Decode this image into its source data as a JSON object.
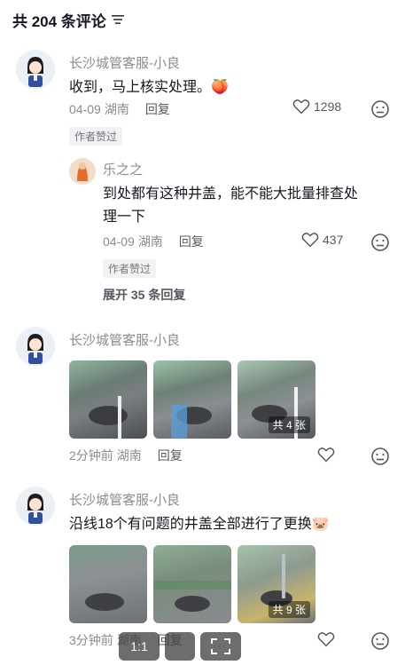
{
  "header": {
    "title": "共 204 条评论",
    "filter_icon": "filter-icon"
  },
  "comments": [
    {
      "author": "长沙城管客服-小良",
      "text": "收到，马上核实处理。",
      "emoji": "🍑",
      "time": "04-09",
      "location": "湖南",
      "reply_label": "回复",
      "likes": "1298",
      "badge": "作者赞过",
      "sub_reply": {
        "author": "乐之之",
        "text_line1": "到处都有这种井盖，能不能大批量排查处",
        "text_line2": "理一下",
        "time": "04-09",
        "location": "湖南",
        "reply_label": "回复",
        "likes": "437",
        "badge": "作者赞过"
      },
      "expand_label": "展开 35 条回复"
    },
    {
      "author": "长沙城管客服-小良",
      "time": "2分钟前",
      "location": "湖南",
      "reply_label": "回复",
      "images_count_label": "共 4 张"
    },
    {
      "author": "长沙城管客服-小良",
      "text": "沿线18个有问题的井盖全部进行了更换",
      "emoji": "🐷",
      "time": "3分钟前",
      "location": "湖南",
      "reply_label": "回复",
      "images_count_label": "共 9 张"
    }
  ],
  "overlay": {
    "btn1": "1:1"
  }
}
